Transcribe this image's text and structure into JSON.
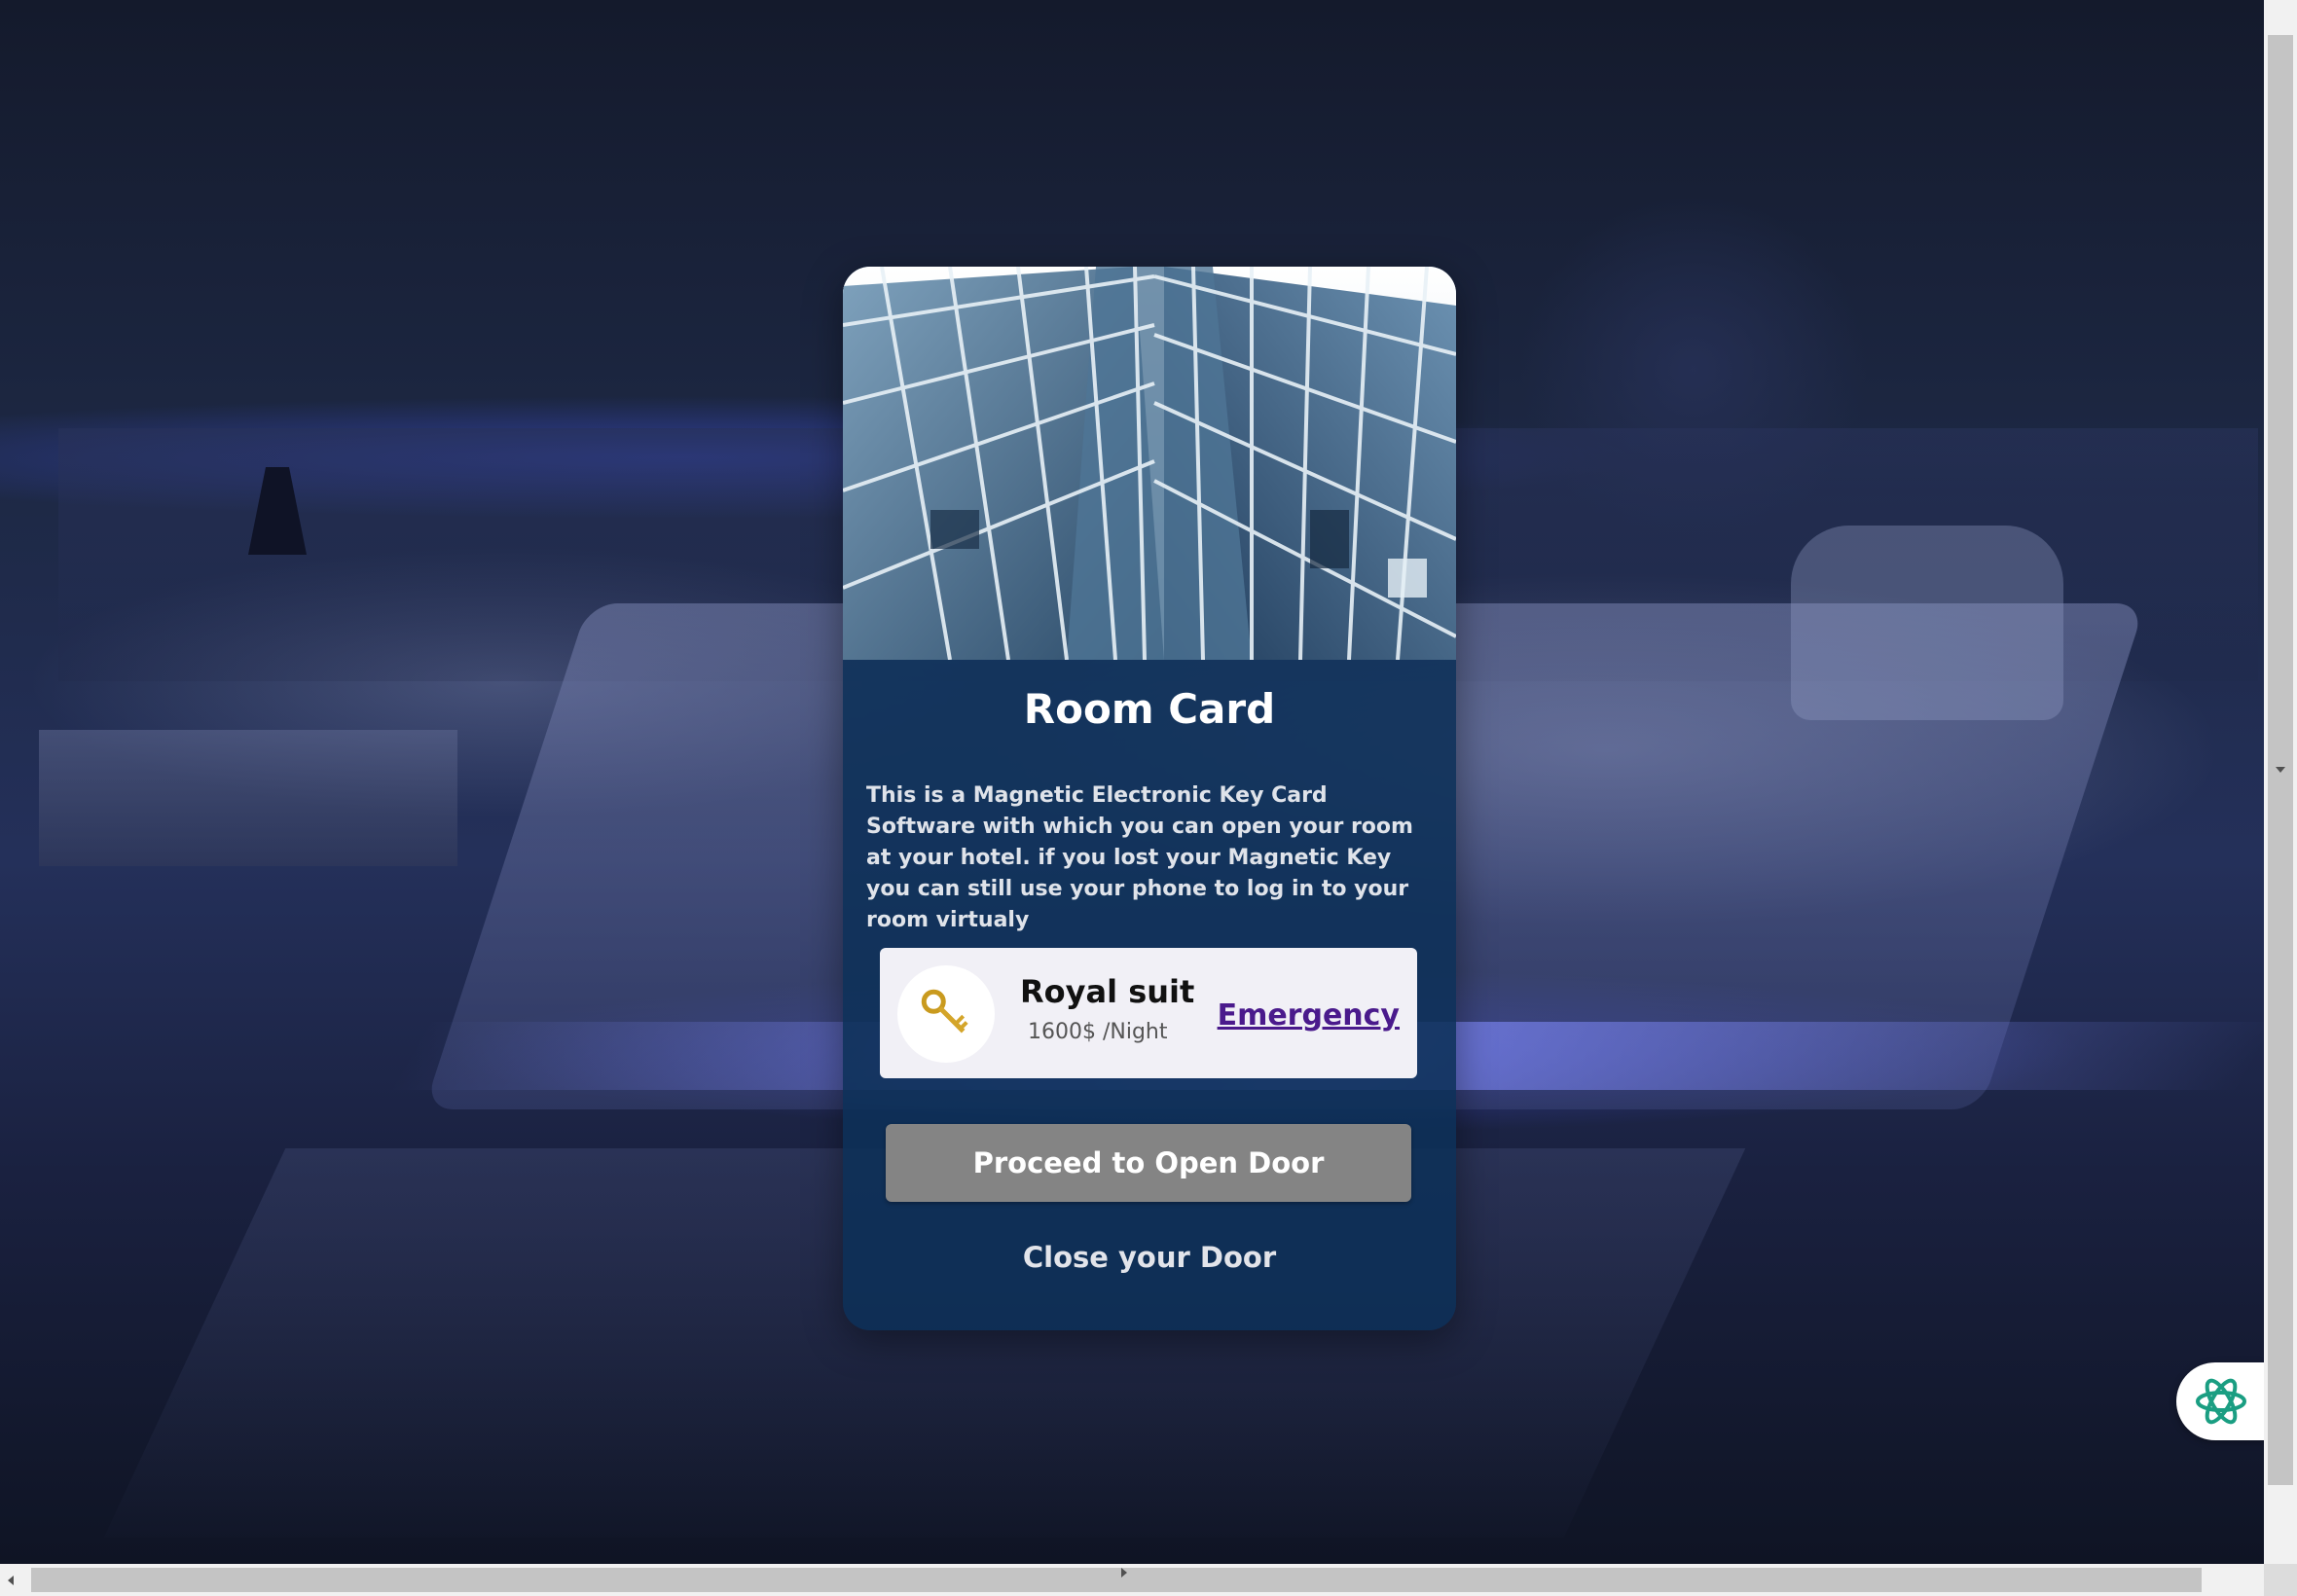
{
  "card": {
    "image_alt": "glass skyscraper facade",
    "title": "Room Card",
    "description": "This is a Magnetic Electronic Key Card Software with which you can open your room at your hotel. if you lost your Magnetic Key you can still use your phone to log in to your room virtualy",
    "room": {
      "icon": "key-icon",
      "name": "Royal suit",
      "price": "1600$ /Night",
      "emergency_label": "Emergency"
    },
    "proceed_label": "Proceed to Open Door",
    "close_label": "Close your Door"
  },
  "assistant": {
    "icon": "assistant-logo-icon"
  },
  "colors": {
    "card_background": "#0d3058",
    "button_gray": "#848484",
    "emergency_link": "#4a1a8c",
    "assistant_green": "#1a9e82"
  }
}
